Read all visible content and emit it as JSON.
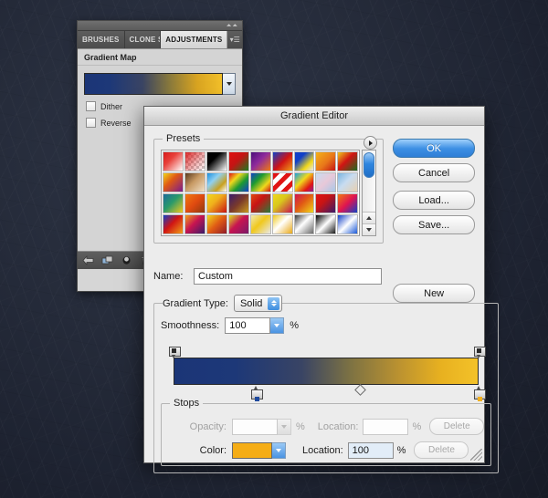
{
  "desktop": {
    "background_color": "#262c3b"
  },
  "panel": {
    "tabs": [
      {
        "label": "BRUSHES",
        "active": false
      },
      {
        "label": "CLONE S",
        "active": false
      },
      {
        "label": "ADJUSTMENTS",
        "active": true
      }
    ],
    "menu_icon": "panel-menu-icon",
    "title": "Gradient Map",
    "gradient_preview": {
      "start_color": "#1b3577",
      "end_color": "#f2c02a",
      "dropdown_icon": "chevron-down-icon"
    },
    "checkboxes": [
      {
        "label": "Dither",
        "checked": false
      },
      {
        "label": "Reverse",
        "checked": false
      }
    ],
    "footer_icons": [
      "back-arrow-icon",
      "clip-layer-icon",
      "visibility-eye-icon",
      "trash-icon"
    ]
  },
  "dialog": {
    "title": "Gradient Editor",
    "presets": {
      "legend": "Presets",
      "menu_icon": "presets-menu-icon",
      "scrollbar": {
        "up_icon": "arrow-up-icon",
        "down_icon": "arrow-down-icon"
      },
      "swatches": [
        {
          "css": "linear-gradient(135deg,#d81b1b 0%,#e8413a 38%,#ffffff 100%)"
        },
        {
          "checker": true,
          "css": "linear-gradient(135deg,rgba(216,27,27,0.95) 0%,rgba(216,27,27,0.35) 55%,rgba(216,27,27,0) 100%)"
        },
        {
          "css": "linear-gradient(135deg,#000000 0%,#000000 35%,#ffffff 100%)"
        },
        {
          "css": "linear-gradient(135deg,#e01010 0%,#c41414 45%,#1d7a20 100%)"
        },
        {
          "css": "linear-gradient(135deg,#4b0f7a 0%,#8e2a9c 45%,#f07a10 100%)"
        },
        {
          "css": "linear-gradient(135deg,#1140c8 0%,#d01414 52%,#f0a018 100%)"
        },
        {
          "css": "linear-gradient(135deg,#1140c8 0%,#1140c8 30%,#f0d81c 70%,#e8e8e8 100%)"
        },
        {
          "css": "linear-gradient(135deg,#f5b216 0%,#e8761a 55%,#c41414 100%)"
        },
        {
          "css": "linear-gradient(135deg,#f0c81c 0%,#d01414 45%,#1d6b20 100%)"
        },
        {
          "css": "linear-gradient(135deg,#f0d41c 0%,#e05a14 40%,#7a1b8e 100%)"
        },
        {
          "css": "linear-gradient(135deg,#5a3a1e 0%,#c89a64 45%,#f0e0c8 100%)"
        },
        {
          "css": "linear-gradient(135deg,#1a8fe0 0%,#8fd0f0 35%,#c8a020 70%,#ffffff 100%)"
        },
        {
          "css": "linear-gradient(135deg,#e01414 0%,#f0d81c 30%,#1d9a30 60%,#1140c8 100%)"
        },
        {
          "css": "linear-gradient(135deg,#1140c8 0%,#1d9a30 35%,#f0d81c 70%,#d01414 100%)"
        },
        {
          "checker": true,
          "css": "repeating-linear-gradient(135deg,#e01414 0px,#e01414 5px,#ffffff 5px,#ffffff 10px)"
        },
        {
          "css": "linear-gradient(135deg,#1aa0e0 0%,#f0d81c 40%,#e01414 75%,#8e1b9c 100%)"
        },
        {
          "css": "linear-gradient(135deg,#c8dcf0 0%,#e8c8d8 50%,#a8c8e8 100%)"
        },
        {
          "css": "linear-gradient(135deg,#7ab4e0 0%,#c8dcf0 45%,#e8d0b0 100%)"
        },
        {
          "css": "linear-gradient(135deg,#1d6b9a 0%,#2a9a6a 45%,#f0c81c 100%)"
        },
        {
          "css": "linear-gradient(135deg,#f07a10 0%,#e04a10 50%,#8e3a10 100%)"
        },
        {
          "css": "linear-gradient(135deg,#f0d81c 0%,#f0b01c 40%,#c81414 100%)"
        },
        {
          "css": "linear-gradient(135deg,#3a1b6a 0%,#7a3a2a 50%,#c89a20 100%)"
        },
        {
          "css": "linear-gradient(135deg,#e04a10 0%,#c81414 40%,#2a7a3a 100%)"
        },
        {
          "css": "linear-gradient(135deg,#f0d81c 0%,#d8c81c 40%,#c81450 100%)"
        },
        {
          "css": "linear-gradient(135deg,#d01450 0%,#e05a14 45%,#f0d81c 100%)"
        },
        {
          "css": "linear-gradient(135deg,#e01414 0%,#c81414 40%,#3a1b6a 100%)"
        },
        {
          "css": "linear-gradient(135deg,#f07a10 0%,#e01450 50%,#1140c8 100%)"
        },
        {
          "css": "linear-gradient(135deg,#1140c8 0%,#d01414 45%,#f0a018 100%)"
        },
        {
          "css": "linear-gradient(135deg,#f0a018 0%,#c81450 45%,#3a1b6a 100%)"
        },
        {
          "css": "linear-gradient(135deg,#f0d81c 0%,#e05a14 50%,#8e1b2a 100%)"
        },
        {
          "css": "linear-gradient(135deg,#d8e01c 0%,#c81450 45%,#7a1b6a 100%)"
        },
        {
          "css": "linear-gradient(135deg,#f0e8b0 0%,#f0c81c 45%,#e8e8e8 100%)"
        },
        {
          "css": "linear-gradient(135deg,#f0c81c 0%,#ffffff 45%,#e8a818 100%)"
        },
        {
          "css": "linear-gradient(135deg,#3a3a3a 0%,#ffffff 45%,#6a6a6a 100%)"
        },
        {
          "css": "linear-gradient(135deg,#000000 0%,#ffffff 50%,#1a1a1a 100%)"
        },
        {
          "css": "linear-gradient(135deg,#1140c8 0%,#ffffff 50%,#1a5ad8 100%)"
        }
      ]
    },
    "buttons": {
      "ok": "OK",
      "cancel": "Cancel",
      "load": "Load...",
      "save": "Save...",
      "new": "New"
    },
    "name": {
      "label": "Name:",
      "value": "Custom"
    },
    "gradient_type": {
      "label": "Gradient Type:",
      "value": "Solid"
    },
    "smoothness": {
      "label": "Smoothness:",
      "value": "100",
      "unit": "%"
    },
    "gradient_bar": {
      "start_color": "#1b3577",
      "end_color": "#f3c229",
      "opacity_stops": [
        {
          "location_percent": 0
        },
        {
          "location_percent": 100
        }
      ],
      "color_stops": [
        {
          "location_percent": 27,
          "color": "#1f4a9e"
        },
        {
          "location_percent": 100,
          "color": "#f2b01e"
        }
      ],
      "midpoint_percent": 61
    },
    "stops": {
      "legend": "Stops",
      "opacity": {
        "label": "Opacity:",
        "value": "",
        "unit": "%",
        "enabled": false
      },
      "opacity_location": {
        "label": "Location:",
        "value": "",
        "unit": "%",
        "enabled": false
      },
      "opacity_delete": {
        "label": "Delete",
        "enabled": false
      },
      "color": {
        "label": "Color:",
        "swatch_color": "#f5ad16",
        "dropdown_icon": "chevron-down-icon"
      },
      "color_location": {
        "label": "Location:",
        "value": "100",
        "unit": "%",
        "enabled": true
      },
      "color_delete": {
        "label": "Delete",
        "enabled": false
      }
    },
    "resize_grip_icon": "resize-grip-icon"
  }
}
